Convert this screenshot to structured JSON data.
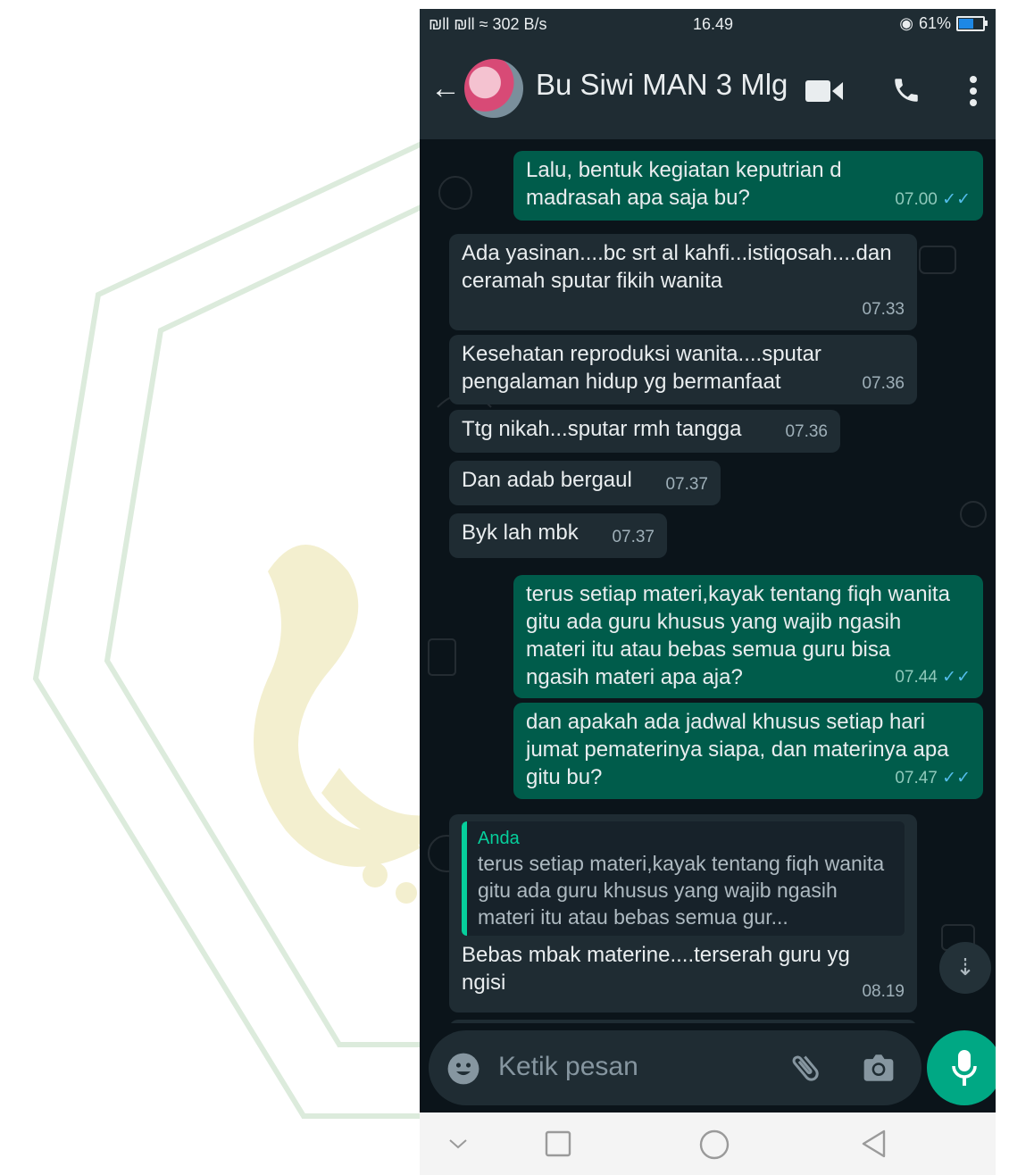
{
  "status_bar": {
    "signal": "₪ll ₪ll",
    "network_speed": "302 B/s",
    "time": "16.49",
    "battery": "61%",
    "battery_level": 0.61
  },
  "header": {
    "back_icon": "arrow-left-icon",
    "contact_name": "Bu Siwi MAN 3 Mlg",
    "video_icon": "video-call-icon",
    "call_icon": "phone-icon",
    "menu_icon": "more-vert-icon"
  },
  "messages": [
    {
      "dir": "out",
      "text": "Lalu, bentuk kegiatan keputrian d madrasah apa saja bu?",
      "time": "07.00",
      "ticks": "✓✓"
    },
    {
      "dir": "in",
      "text": "Ada yasinan....bc srt al kahfi...istiqosah....dan ceramah sputar fikih wanita",
      "time": "07.33"
    },
    {
      "dir": "in",
      "text": "Kesehatan reproduksi wanita....sputar pengalaman hidup yg bermanfaat",
      "time": "07.36"
    },
    {
      "dir": "in",
      "text": "Ttg nikah...sputar rmh tangga",
      "time": "07.36"
    },
    {
      "dir": "in",
      "text": "Dan adab bergaul",
      "time": "07.37"
    },
    {
      "dir": "in",
      "text": "Byk lah mbk",
      "time": "07.37"
    },
    {
      "dir": "out",
      "text": "terus setiap materi,kayak tentang fiqh wanita gitu ada guru khusus yang wajib ngasih materi itu atau bebas semua guru bisa ngasih materi apa aja?",
      "time": "07.44",
      "ticks": "✓✓"
    },
    {
      "dir": "out",
      "text": "dan apakah ada jadwal khusus setiap hari jumat pematerinya siapa, dan materinya apa gitu bu?",
      "time": "07.47",
      "ticks": "✓✓"
    },
    {
      "dir": "in",
      "quote_author": "Anda",
      "quote_text": "terus setiap materi,kayak tentang fiqh wanita gitu ada guru khusus yang wajib ngasih materi itu atau bebas semua gur...",
      "text": "Bebas mbak materine....terserah guru yg ngisi",
      "time": "08.19"
    }
  ],
  "composer": {
    "emoji_icon": "emoji-icon",
    "placeholder": "Ketik pesan",
    "attach_icon": "paperclip-icon",
    "camera_icon": "camera-icon",
    "mic_icon": "microphone-icon"
  },
  "scroll_down_icon": "double-chevron-down-icon",
  "nav_bar": {
    "icons": [
      "chevron-down-icon",
      "square-icon",
      "circle-icon",
      "triangle-back-icon"
    ]
  },
  "colors": {
    "header": "#1f2c33",
    "chat_bg": "#0b141a",
    "incoming": "#1f2c33",
    "outgoing": "#005c4b",
    "accent": "#00a884",
    "read_ticks": "#53bdeb"
  }
}
